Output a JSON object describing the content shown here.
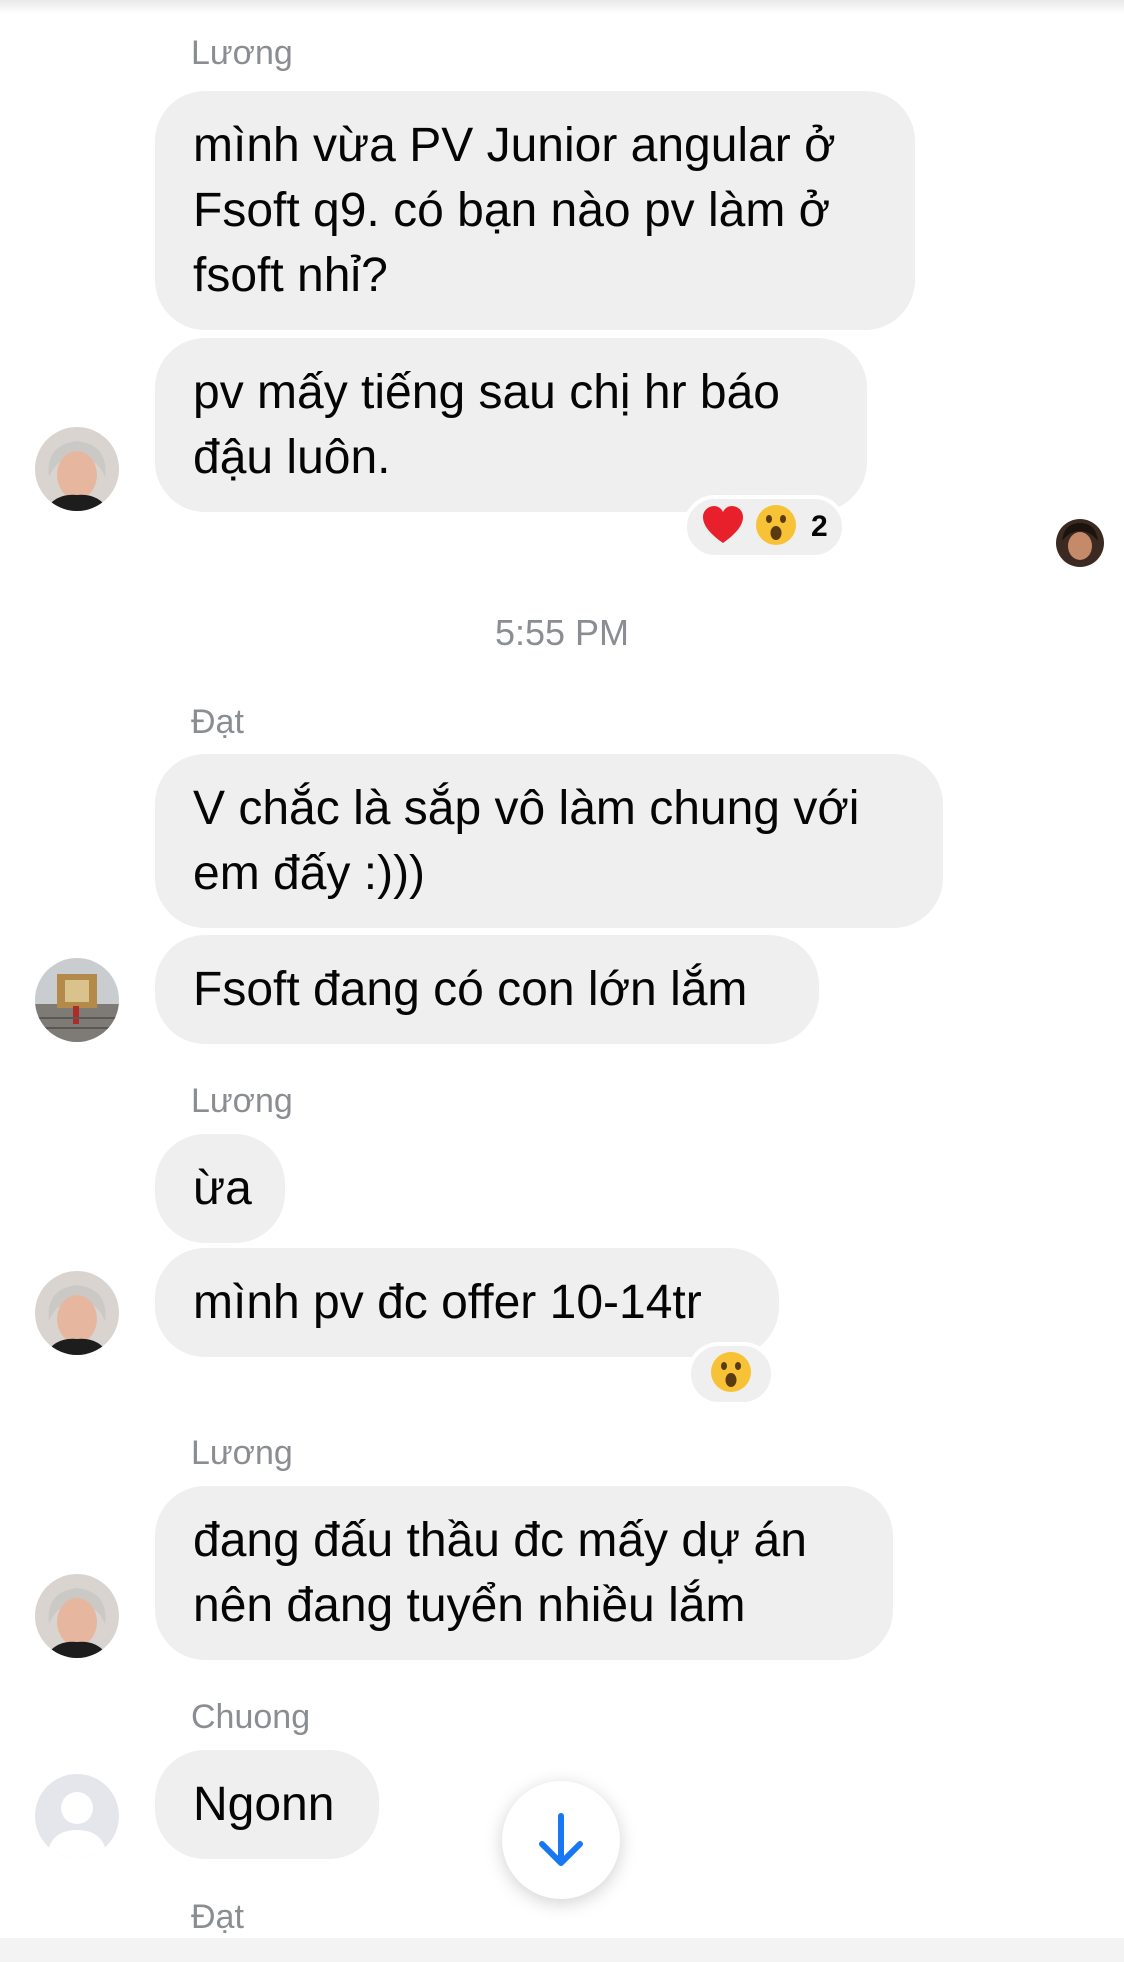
{
  "colors": {
    "bubble": "#efefef",
    "meta_text": "#8a8d91",
    "accent": "#1877f2"
  },
  "messages": [
    {
      "sender": "Lương",
      "texts": [
        "mình vừa PV Junior angular ở\nFsoft q9. có bạn nào pv làm ở\nfsoft nhỉ?",
        "pv mấy tiếng sau chị hr báo\nđậu luôn."
      ],
      "reactions": {
        "icons": [
          "heart-icon",
          "wow-icon"
        ],
        "count": "2"
      }
    },
    {
      "timestamp": "5:55 PM"
    },
    {
      "sender": "Đạt",
      "texts": [
        "V chắc là sắp vô làm chung với\nem đấy :)))",
        "Fsoft đang có con lớn lắm"
      ]
    },
    {
      "sender": "Lương",
      "texts": [
        "ừa",
        "mình pv đc offer 10-14tr"
      ],
      "reactions": {
        "icons": [
          "wow-icon"
        ]
      }
    },
    {
      "sender": "Lương",
      "texts": [
        "đang đấu thầu đc mấy dự án\nnên đang tuyển nhiều lắm"
      ]
    },
    {
      "sender": "Chuong",
      "texts": [
        "Ngonn"
      ]
    },
    {
      "sender": "Đạt"
    }
  ]
}
